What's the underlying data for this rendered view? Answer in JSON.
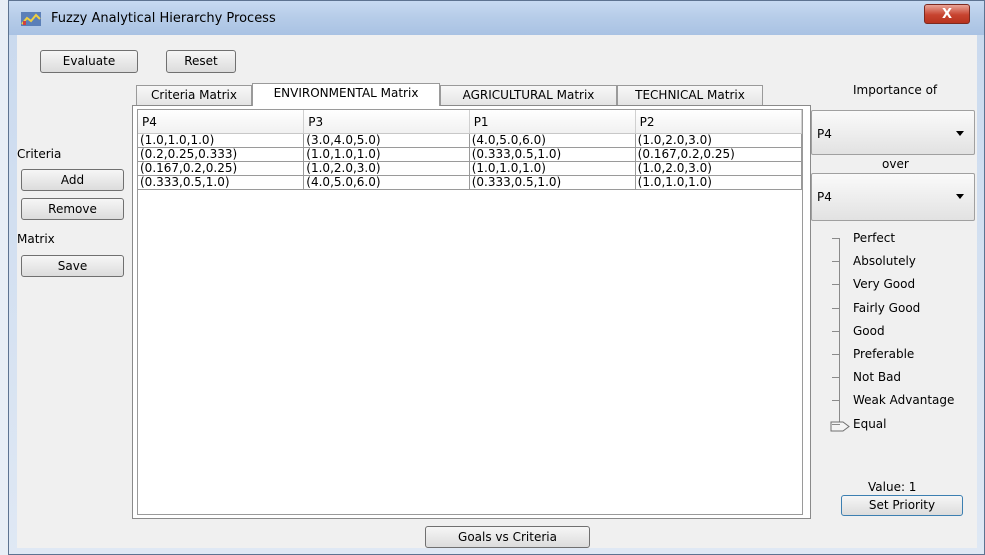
{
  "window": {
    "title": "Fuzzy Analytical Hierarchy Process",
    "close_label": "X"
  },
  "toolbar": {
    "evaluate_label": "Evaluate",
    "reset_label": "Reset"
  },
  "left": {
    "criteria_label": "Criteria",
    "add_label": "Add",
    "remove_label": "Remove",
    "matrix_label": "Matrix",
    "save_label": "Save"
  },
  "tabs": [
    {
      "label": "Criteria Matrix",
      "active": false
    },
    {
      "label": "ENVIRONMENTAL Matrix",
      "active": true
    },
    {
      "label": "AGRICULTURAL Matrix",
      "active": false
    },
    {
      "label": "TECHNICAL Matrix",
      "active": false
    }
  ],
  "matrix": {
    "columns": [
      "P4",
      "P3",
      "P1",
      "P2"
    ],
    "rows": [
      [
        "(1.0,1.0,1.0)",
        "(3.0,4.0,5.0)",
        "(4.0,5.0,6.0)",
        "(1.0,2.0,3.0)"
      ],
      [
        "(0.2,0.25,0.333)",
        "(1.0,1.0,1.0)",
        "(0.333,0.5,1.0)",
        "(0.167,0.2,0.25)"
      ],
      [
        "(0.167,0.2,0.25)",
        "(1.0,2.0,3.0)",
        "(1.0,1.0,1.0)",
        "(1.0,2.0,3.0)"
      ],
      [
        "(0.333,0.5,1.0)",
        "(4.0,5.0,6.0)",
        "(0.333,0.5,1.0)",
        "(1.0,1.0,1.0)"
      ]
    ]
  },
  "importance": {
    "heading": "Importance of",
    "first_value": "P4",
    "over_label": "over",
    "second_value": "P4"
  },
  "scale": {
    "labels": [
      "Perfect",
      "Absolutely",
      "Very Good",
      "Fairly Good",
      "Good",
      "Preferable",
      "Not Bad",
      "Weak Advantage",
      "Equal"
    ],
    "selected_level": 1
  },
  "value_text": "Value: 1",
  "set_priority_label": "Set Priority",
  "goals_label": "Goals vs Criteria"
}
